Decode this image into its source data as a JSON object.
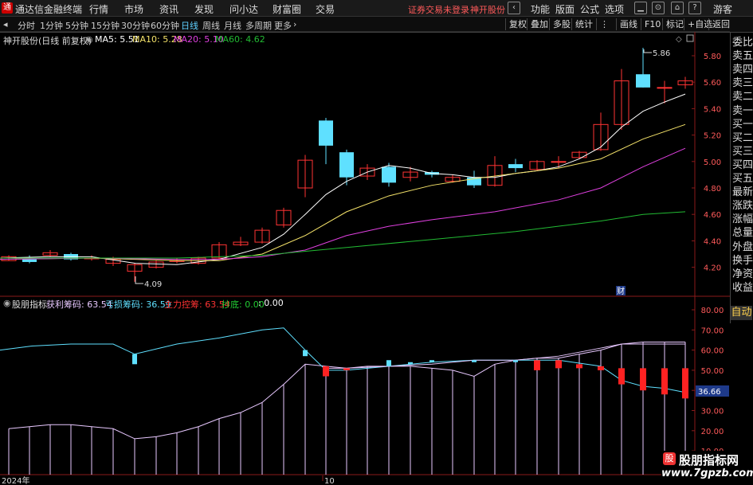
{
  "app": {
    "title": "通达信金融终端",
    "menu": [
      "行情",
      "市场",
      "资讯",
      "发现",
      "问小达",
      "财富圈",
      "交易"
    ],
    "warning": "证券交易未登录",
    "stock_name_top": "神开股份",
    "right_menu": [
      "功能",
      "版面",
      "公式",
      "选项"
    ],
    "guest": "游客"
  },
  "toolbar": {
    "periods": [
      "分时",
      "1分钟",
      "5分钟",
      "15分钟",
      "30分钟",
      "60分钟",
      "日线",
      "周线",
      "月线",
      "多周期",
      "更多"
    ],
    "active_period": "日线",
    "buttons": [
      "复权",
      "叠加",
      "多股",
      "统计",
      "画线",
      "F10",
      "标记",
      "+自选",
      "返回"
    ]
  },
  "main_chart": {
    "header": "神开股份(日线 前复权)",
    "ma_labels": [
      {
        "text": "MA5: 5.51",
        "color": "#ffffff"
      },
      {
        "text": "MA10: 5.28",
        "color": "#f5e36a"
      },
      {
        "text": "MA20: 5.10",
        "color": "#e040e0"
      },
      {
        "text": "MA60: 4.62",
        "color": "#22bb33"
      }
    ],
    "y_ticks": [
      "5.80",
      "5.60",
      "5.40",
      "5.20",
      "5.00",
      "4.80",
      "4.60",
      "4.40",
      "4.20"
    ],
    "high_label": "5.86",
    "low_label": "4.09",
    "fin_marker": "财"
  },
  "indicator": {
    "name": "股朋指标",
    "fields": [
      {
        "text": "获利筹码: 63.54",
        "color": "#e8c8ff"
      },
      {
        "text": "亏损筹码: 36.59",
        "color": "#5fe0ff"
      },
      {
        "text": "主力控筹: 63.54",
        "color": "#ff3333"
      },
      {
        "text": "抄底: 0.00",
        "color": "#22cc33"
      },
      {
        "text": ": 0.00",
        "color": "#ffffff"
      }
    ],
    "y_ticks": [
      "80.00",
      "70.00",
      "60.00",
      "50.00",
      "40.00",
      "30.00",
      "20.00",
      "10.00"
    ],
    "current_value": "36.66"
  },
  "x_axis": {
    "year": "2024年",
    "month": "10"
  },
  "side_panel": {
    "items": [
      "委比",
      "卖五",
      "卖四",
      "卖三",
      "卖二",
      "卖一",
      "买一",
      "买二",
      "买三",
      "买四",
      "买五",
      "最新",
      "涨跌",
      "涨幅",
      "总量",
      "外盘",
      "换手",
      "净资",
      "收益"
    ],
    "auto": "自动"
  },
  "watermark": {
    "title": "股朋指标网",
    "url": "www.7gpzb.com"
  },
  "colors": {
    "up": "#ff3333",
    "down": "#5fe0ff",
    "ma5": "#ffffff",
    "ma10": "#f5e36a",
    "ma20": "#e040e0",
    "ma60": "#22bb33"
  }
}
